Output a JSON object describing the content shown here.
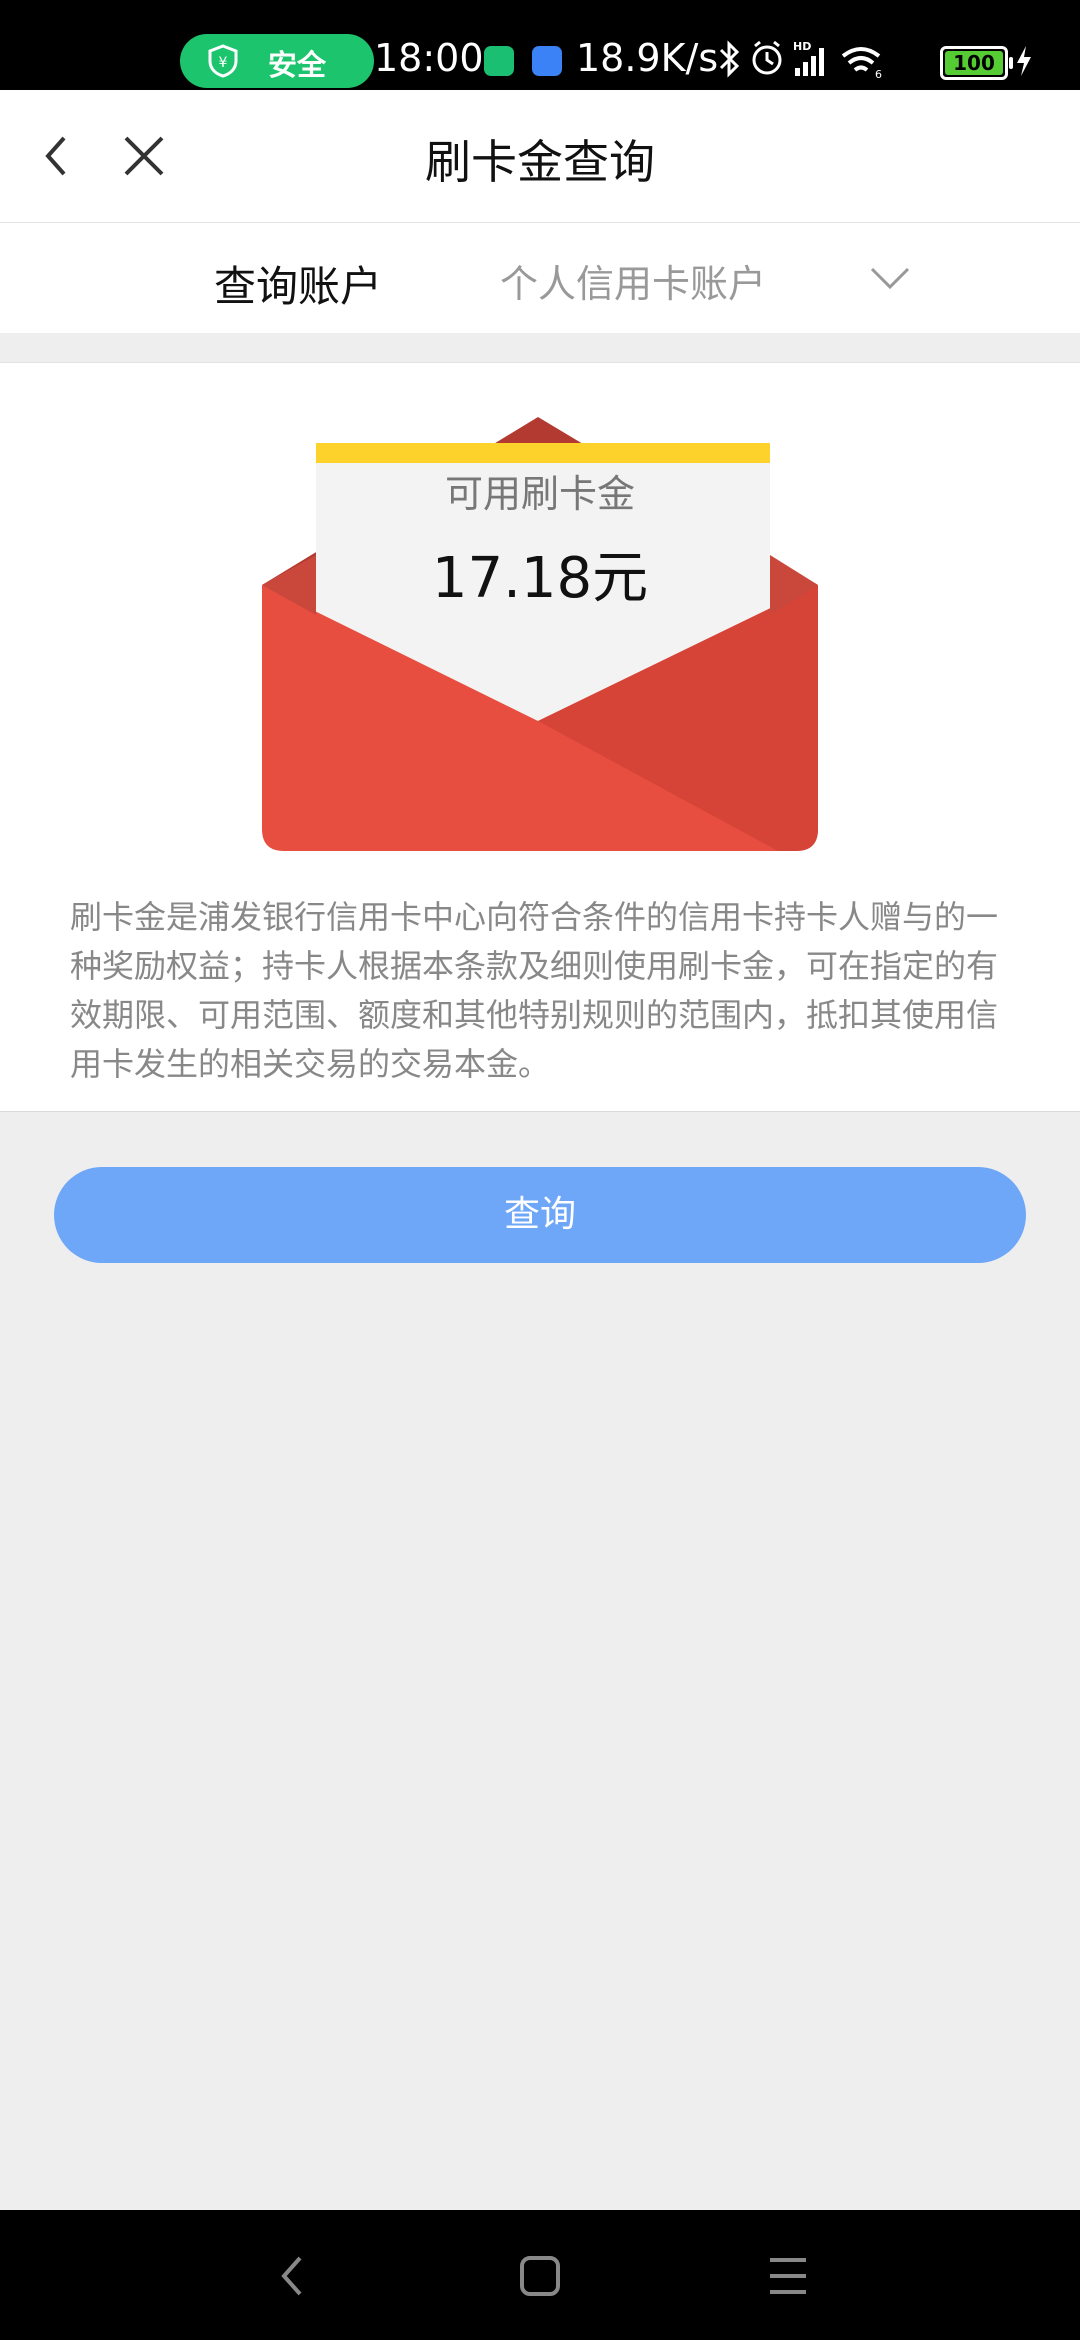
{
  "status_bar": {
    "security_label": "安全",
    "time": "18:00",
    "network_speed": "18.9K/s",
    "battery": "100",
    "icons": [
      "shield-yen-icon",
      "app-icon-green",
      "app-icon-blue",
      "bluetooth-icon",
      "alarm-icon",
      "hd-signal-icon",
      "wifi-icon",
      "battery-icon",
      "charging-icon"
    ]
  },
  "header": {
    "title": "刷卡金查询"
  },
  "account": {
    "label": "查询账户",
    "value": "个人信用卡账户"
  },
  "envelope": {
    "label": "可用刷卡金",
    "amount": "17.18元"
  },
  "description": "刷卡金是浦发银行信用卡中心向符合条件的信用卡持卡人赠与的一种奖励权益；持卡人根据本条款及细则使用刷卡金，可在指定的有效期限、可用范围、额度和其他特别规则的范围内，抵扣其使用信用卡发生的相关交易的交易本金。",
  "query_button": "查询",
  "colors": {
    "primary_button": "#6ea6f8",
    "envelope_red": "#e84e3f",
    "envelope_dark": "#b23a30",
    "gold_strip": "#fdd22a",
    "security_green": "#1cc56d"
  }
}
